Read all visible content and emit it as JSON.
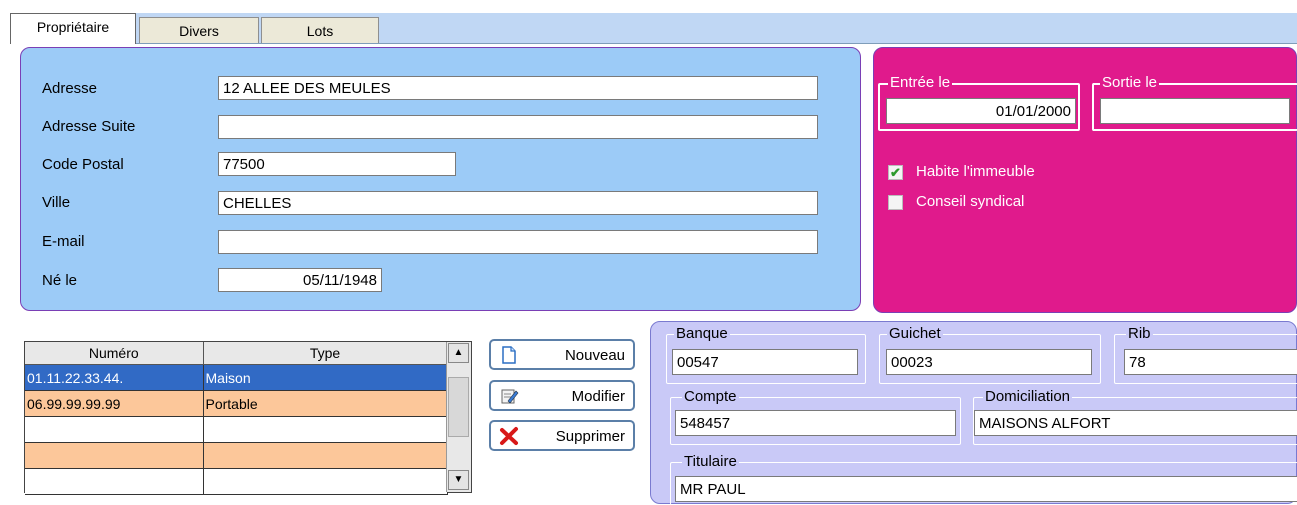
{
  "tabs": [
    {
      "label": "Propriétaire",
      "active": true
    },
    {
      "label": "Divers",
      "active": false
    },
    {
      "label": "Lots",
      "active": false
    }
  ],
  "address": {
    "adresse_label": "Adresse",
    "adresse_value": "12 ALLEE DES MEULES",
    "adresse_suite_label": "Adresse Suite",
    "adresse_suite_value": "",
    "code_postal_label": "Code Postal",
    "code_postal_value": "77500",
    "ville_label": "Ville",
    "ville_value": "CHELLES",
    "email_label": "E-mail",
    "email_value": "",
    "ne_le_label": "Né le",
    "ne_le_value": "05/11/1948"
  },
  "status": {
    "entree_label": "Entrée le",
    "entree_value": "01/01/2000",
    "sortie_label": "Sortie le",
    "sortie_value": "",
    "habite_label": "Habite l'immeuble",
    "habite_checked": true,
    "conseil_label": "Conseil syndical",
    "conseil_checked": false
  },
  "phones": {
    "columns": [
      "Numéro",
      "Type"
    ],
    "rows": [
      {
        "numero": "01.11.22.33.44.",
        "type": "Maison"
      },
      {
        "numero": "06.99.99.99.99",
        "type": "Portable"
      },
      {
        "numero": "",
        "type": ""
      },
      {
        "numero": "",
        "type": ""
      },
      {
        "numero": "",
        "type": ""
      }
    ]
  },
  "actions": {
    "nouveau": "Nouveau",
    "modifier": "Modifier",
    "supprimer": "Supprimer"
  },
  "bank": {
    "banque_label": "Banque",
    "banque_value": "00547",
    "guichet_label": "Guichet",
    "guichet_value": "00023",
    "rib_label": "Rib",
    "rib_value": "78",
    "compte_label": "Compte",
    "compte_value": "548457",
    "domiciliation_label": "Domiciliation",
    "domiciliation_value": "MAISONS ALFORT",
    "titulaire_label": "Titulaire",
    "titulaire_value": "MR PAUL"
  },
  "colors": {
    "tab_bar": "#c0d7f4",
    "address_panel": "#9ccbf7",
    "status_panel": "#e01a8c",
    "bank_panel": "#c9c9f7",
    "selected_row": "#316ac5",
    "alt_row": "#fcc79a"
  }
}
